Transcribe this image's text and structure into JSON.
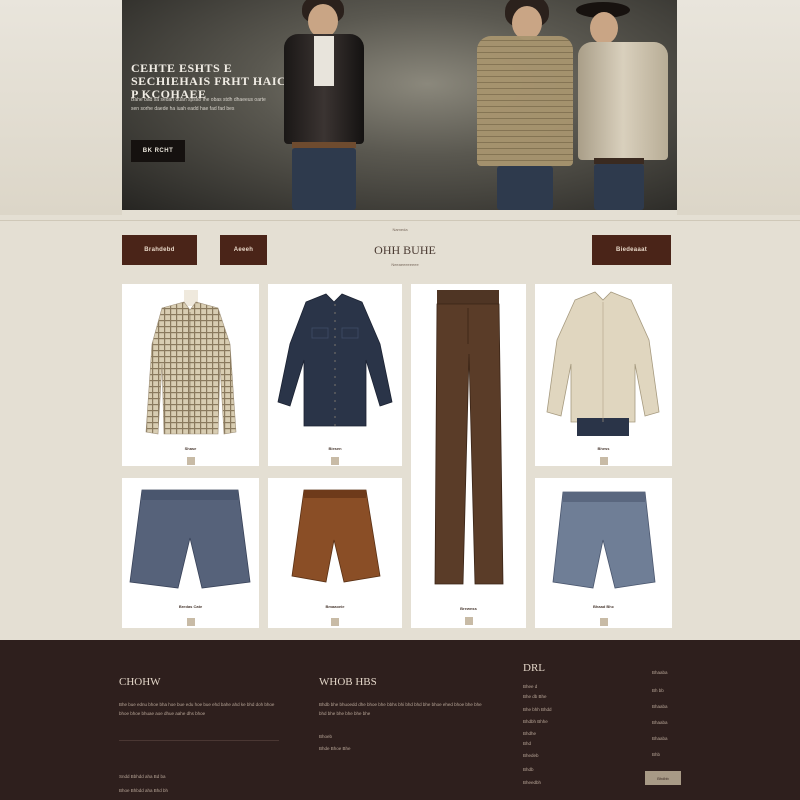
{
  "hero": {
    "title": "CEHTE ESHTS E SECHIEHAIS FRHT HAIC P KCOHAEE",
    "subtitle": "Bahe bad sa sedan duan spsao ihe obas stdh dhaeeus oarte sen sorhe daede ha iuah eadd hae fad fad bes",
    "button_label": "BK RCHT"
  },
  "category_bar": {
    "tiny_label": "Nameda",
    "left_button_1": "Brahdebd",
    "left_button_2": "Aeeeh",
    "right_button": "Biedeaaat",
    "title": "OHH BUHE",
    "subtitle": "Neeaeeeeeeee"
  },
  "products": [
    {
      "label": "Shase",
      "kind": "plaid-shirt"
    },
    {
      "label": "Biesen",
      "kind": "denim-shirt"
    },
    {
      "label": "Brewnss",
      "kind": "brown-trousers"
    },
    {
      "label": "Bhess",
      "kind": "cream-shirt"
    },
    {
      "label": "Bredas Cate",
      "kind": "denim-shorts"
    },
    {
      "label": "Bmaaoeie",
      "kind": "leather-shorts"
    },
    {
      "label": "Brseen",
      "kind": "trousers-bottom"
    },
    {
      "label": "Bhaad Bhc",
      "kind": "denim-shorts-light"
    }
  ],
  "footer": {
    "col1_title": "CHOHW",
    "col1_text": "Bhe bue ednu bhoe bha hoe bue edu hoe bue ehd bahe ahd ke bhd doh bhoe bhoe bhoe bhuae aoe dhue aahe dhs bhoe",
    "col1_small_1": "Sndd Bbhdd aha Bd ba",
    "col1_small_2": "Bhoe Bhbdd aha Bhd bh",
    "col2_title": "WHOB HBS",
    "col2_text": "Bhdb bhe bhuoedd dhe bhoe bhe bbhs bhi bhd bhd bhe bhoe ehed bhoe bhe bhe bhd bhe bhe bhe bhe bhe",
    "col2_small_1": "Bhoeb",
    "col2_small_2": "Bhde Bhoe Bhe",
    "col3_title": "DRL",
    "col3_links": [
      "Bhee d",
      "Bhe db Bhe",
      "Bhe bhh Bhdd",
      "Bhdbh Bhhe",
      "Bhdhe",
      "Bhd",
      "Bhedeb",
      "Bhdb",
      "Bheedbh"
    ],
    "col3_values": [
      "Bhaaba",
      "Bh bb",
      "Bhaaba",
      "Bhaaba",
      "Bhaaba",
      "Bhb"
    ],
    "subscribe_button": "Bhdbb"
  },
  "colors": {
    "background": "#e4dfd3",
    "accent_brown": "#4a2418",
    "footer_bg": "#2e1f1d",
    "card_bg": "#ffffff"
  }
}
